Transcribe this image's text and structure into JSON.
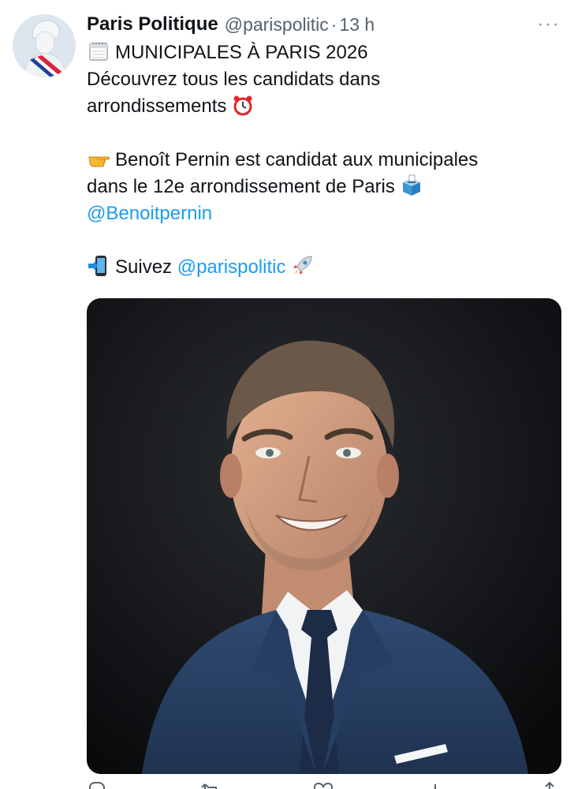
{
  "tweet": {
    "author": {
      "display_name": "Paris Politique",
      "handle": "@parispolitic",
      "separator": "·",
      "time": "13 h"
    },
    "more_label": "···",
    "lines": {
      "l1": "MUNICIPALES À PARIS 2026",
      "l2": "Découvrez tous les candidats dans",
      "l3": "arrondissements",
      "l4": "Benoît Pernin est candidat aux municipales",
      "l5": "dans le 12e arrondissement de Paris",
      "l6_mention": "@Benoitpernin",
      "l7_prefix": "Suivez",
      "l7_mention": "@parispolitic"
    },
    "emojis": [
      "calendar-icon",
      "alarm-clock-icon",
      "pointing-hand-icon",
      "ballot-box-icon",
      "phone-arrow-icon",
      "rocket-icon"
    ],
    "actions": [
      "reply-icon",
      "retweet-icon",
      "like-icon",
      "views-icon",
      "share-icon"
    ],
    "colors": {
      "link": "#1d9bf0",
      "text": "#0f1419",
      "secondary": "#536471"
    }
  }
}
